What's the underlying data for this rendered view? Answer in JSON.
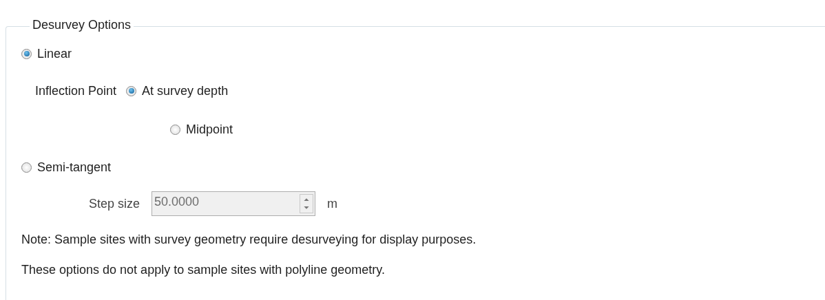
{
  "group": {
    "title": "Desurvey Options"
  },
  "linear": {
    "label": "Linear",
    "selected": true
  },
  "inflection": {
    "label": "Inflection Point",
    "options": [
      {
        "label": "At survey depth",
        "selected": true
      },
      {
        "label": "Midpoint",
        "selected": false
      }
    ]
  },
  "semi_tangent": {
    "label": "Semi-tangent",
    "selected": false
  },
  "step_size": {
    "label": "Step size",
    "value": "50.0000",
    "disabled": true,
    "unit": "m"
  },
  "notes": [
    "Note: Sample sites with survey geometry require desurveying for display purposes.",
    "These options do not apply to sample sites with polyline geometry."
  ]
}
